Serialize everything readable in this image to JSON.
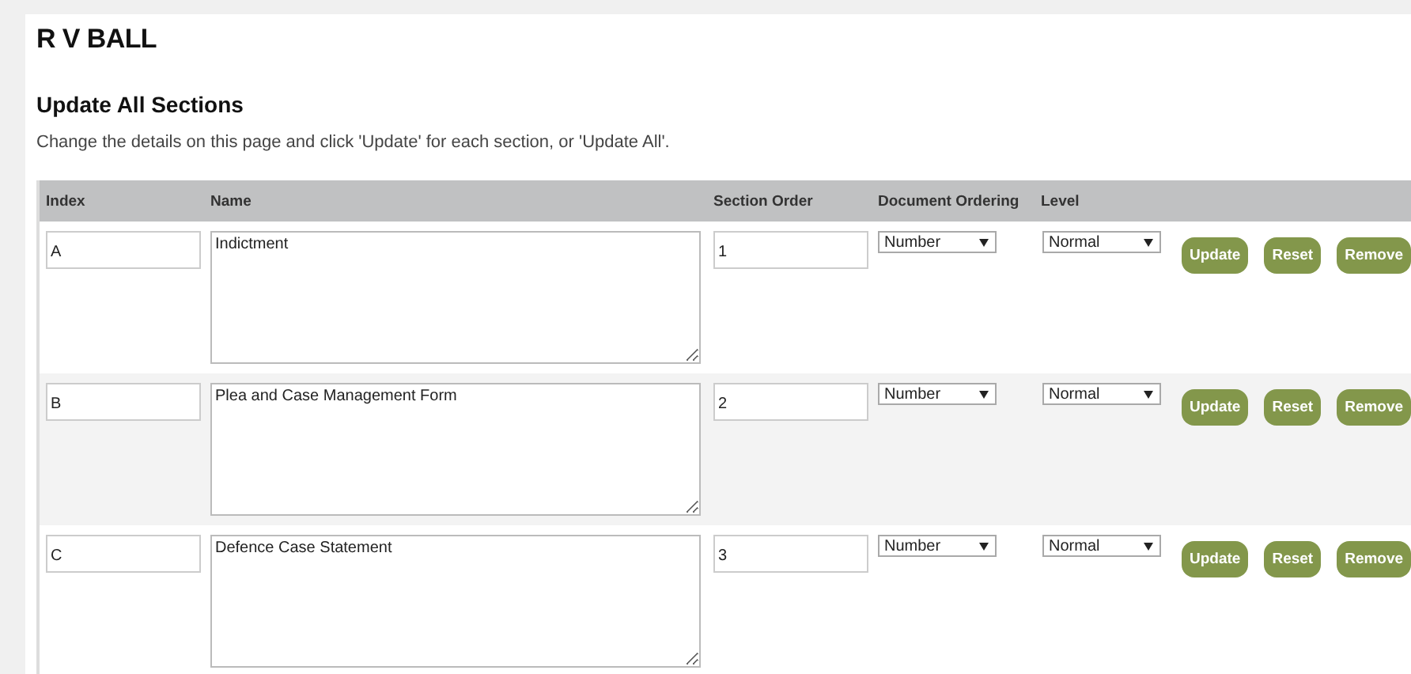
{
  "page_title": "R V BALL",
  "heading": "Update All Sections",
  "description": "Change the details on this page and click 'Update' for each section, or 'Update All'.",
  "table": {
    "columns": [
      "Index",
      "Name",
      "Section Order",
      "Document Ordering",
      "Level"
    ],
    "rows": [
      {
        "index": "A",
        "name": "Indictment",
        "section_order": "1",
        "document_ordering": "Number",
        "level": "Normal",
        "buttons": [
          "Update",
          "Reset",
          "Remove"
        ]
      },
      {
        "index": "B",
        "name": "Plea and Case Management Form",
        "section_order": "2",
        "document_ordering": "Number",
        "level": "Normal",
        "buttons": [
          "Update",
          "Reset",
          "Remove"
        ]
      },
      {
        "index": "C",
        "name": "Defence Case Statement",
        "section_order": "3",
        "document_ordering": "Number",
        "level": "Normal",
        "buttons": [
          "Update",
          "Reset",
          "Remove"
        ]
      }
    ]
  }
}
